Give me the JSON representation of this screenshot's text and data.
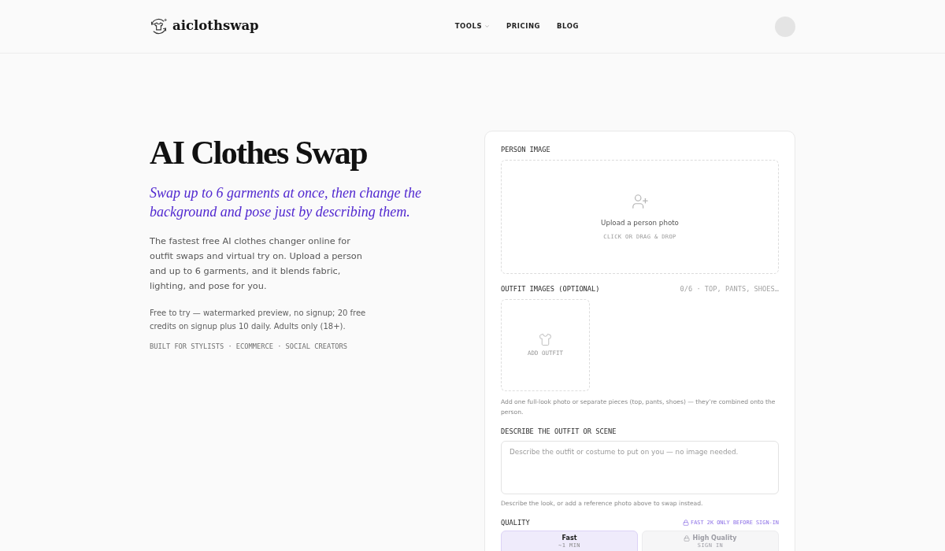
{
  "header": {
    "logo": "aiclothswap",
    "nav": [
      {
        "label": "TOOLS",
        "kind": "dropdown"
      },
      {
        "label": "PRICING",
        "kind": "link"
      },
      {
        "label": "BLOG",
        "kind": "link"
      }
    ]
  },
  "hero": {
    "title": "AI Clothes Swap",
    "subtitle": "Swap up to 6 garments at once, then change the background and pose just by describing them.",
    "description": "The fastest free AI clothes changer online for outfit swaps and virtual try on. Upload a person and up to 6 garments, and it blends fabric, lighting, and pose for you.",
    "note": "Free to try — watermarked preview, no signup; 20 free credits on signup plus 10 daily. Adults only (18+).",
    "tagline": "BUILT FOR STYLISTS · ECOMMERCE · SOCIAL CREATORS"
  },
  "form": {
    "person_image": {
      "label": "PERSON IMAGE",
      "prompt": "Upload a person photo",
      "hint": "CLICK OR DRAG & DROP"
    },
    "outfit_images": {
      "label": "OUTFIT IMAGES (OPTIONAL)",
      "count": "0/6 · TOP, PANTS, SHOES…",
      "add_label": "ADD OUTFIT",
      "help": "Add one full-look photo or separate pieces (top, pants, shoes) — they’re combined onto the person."
    },
    "description": {
      "label": "DESCRIBE THE OUTFIT OR SCENE",
      "placeholder": "Describe the outfit or costume to put on you — no image needed.",
      "help": "Describe the look, or add a reference photo above to swap instead."
    },
    "quality": {
      "label": "QUALITY",
      "notice": "FAST 2K ONLY BEFORE SIGN-IN",
      "options": [
        {
          "label": "Fast",
          "sub": "~1 MIN",
          "selected": true,
          "disabled": false
        },
        {
          "label": "High Quality",
          "sub": "SIGN IN",
          "selected": false,
          "disabled": true
        }
      ]
    }
  }
}
